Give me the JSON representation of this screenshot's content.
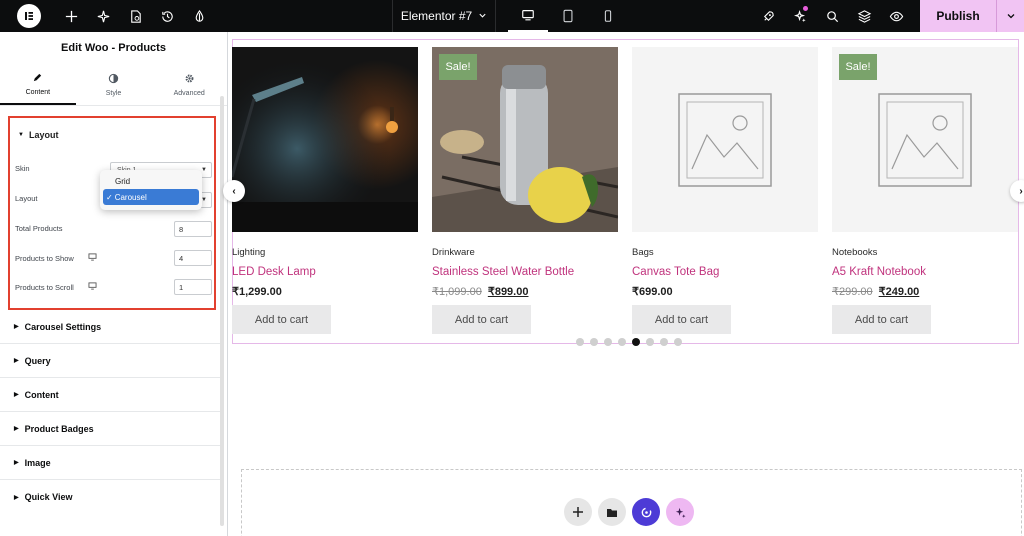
{
  "topbar": {
    "document_title": "Elementor #7",
    "publish_label": "Publish",
    "icons": [
      "elementor-logo",
      "add-icon",
      "site-settings-icon",
      "page-settings-icon",
      "history-icon",
      "theme-style-icon",
      "responsive-desktop-icon",
      "responsive-tablet-icon",
      "responsive-mobile-icon",
      "rocket-icon",
      "ai-notifications-icon",
      "search-icon",
      "structure-layers-icon",
      "preview-eye-icon"
    ]
  },
  "panel": {
    "title": "Edit Woo - Products",
    "tabs": [
      {
        "label": "Content",
        "icon": "pencil-icon",
        "active": true
      },
      {
        "label": "Style",
        "icon": "contrast-icon",
        "active": false
      },
      {
        "label": "Advanced",
        "icon": "gear-icon",
        "active": false
      }
    ],
    "layout_section": {
      "title": "Layout",
      "skin_label": "Skin",
      "skin_value": "Skin 1",
      "layout_label": "Layout",
      "layout_options": [
        "Grid",
        "Carousel"
      ],
      "layout_selected": "Carousel",
      "total_products_label": "Total Products",
      "total_products_value": "8",
      "products_to_show_label": "Products to Show",
      "products_to_show_value": "4",
      "products_to_scroll_label": "Products to Scroll",
      "products_to_scroll_value": "1"
    },
    "sections": [
      "Carousel Settings",
      "Query",
      "Content",
      "Product Badges",
      "Image",
      "Quick View"
    ]
  },
  "products": [
    {
      "category": "Lighting",
      "name": "LED Desk Lamp",
      "old_price": "",
      "price": "₹1,299.00",
      "sale": false,
      "image": "desk-lamp-photo",
      "button": "Add to cart"
    },
    {
      "category": "Drinkware",
      "name": "Stainless Steel Water Bottle",
      "old_price": "₹1,099.00",
      "price": "₹899.00",
      "sale": true,
      "sale_label": "Sale!",
      "image": "water-bottle-photo",
      "button": "Add to cart"
    },
    {
      "category": "Bags",
      "name": "Canvas Tote Bag",
      "old_price": "",
      "price": "₹699.00",
      "sale": false,
      "image": "placeholder-image",
      "button": "Add to cart"
    },
    {
      "category": "Notebooks",
      "name": "A5 Kraft Notebook",
      "old_price": "₹299.00",
      "price": "₹249.00",
      "sale": true,
      "sale_label": "Sale!",
      "image": "placeholder-image",
      "button": "Add to cart"
    }
  ],
  "carousel": {
    "dot_count": 8,
    "active_dot": 5
  },
  "colors": {
    "accent_publish": "#f1c4f3",
    "product_link": "#c0337d",
    "sale_badge": "#7aa36b",
    "highlight_box": "#e2402f",
    "frame_border": "#e5b8e8"
  }
}
